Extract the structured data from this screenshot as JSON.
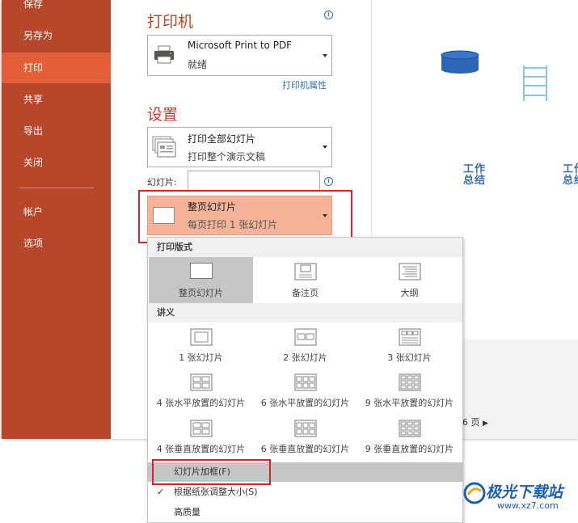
{
  "sidebar": {
    "items": [
      {
        "label": "保存"
      },
      {
        "label": "另存为"
      },
      {
        "label": "打印"
      },
      {
        "label": "共享"
      },
      {
        "label": "导出"
      },
      {
        "label": "关闭"
      },
      {
        "label": "帐户"
      },
      {
        "label": "选项"
      }
    ],
    "active_index": 2,
    "bg_color": "#b7472a",
    "active_color": "#e25f37"
  },
  "printer": {
    "heading": "打印机",
    "name": "Microsoft Print to PDF",
    "status": "就绪",
    "properties_link": "打印机属性"
  },
  "settings": {
    "heading": "设置",
    "range": {
      "title": "打印全部幻灯片",
      "subtitle": "打印整个演示文稿"
    },
    "slides_label": "幻灯片:",
    "slides_value": "",
    "layout": {
      "title": "整页幻灯片",
      "subtitle": "每页打印 1 张幻灯片",
      "highlight_color": "#f5b49a"
    }
  },
  "preview": {
    "texts": [
      "工作\n总结",
      "工作\n总结"
    ],
    "page_count": "6 页"
  },
  "layout_menu": {
    "section_print_layout": "打印版式",
    "print_layout_options": [
      {
        "label": "整页幻灯片",
        "icon": "full-page-slide-icon",
        "selected": true
      },
      {
        "label": "备注页",
        "icon": "notes-page-icon",
        "selected": false
      },
      {
        "label": "大纲",
        "icon": "outline-icon",
        "selected": false
      }
    ],
    "section_handouts": "讲义",
    "handout_options": [
      {
        "label": "1 张幻灯片",
        "icon": "handout-1-icon"
      },
      {
        "label": "2 张幻灯片",
        "icon": "handout-2-icon"
      },
      {
        "label": "3 张幻灯片",
        "icon": "handout-3-icon"
      },
      {
        "label": "4 张水平放置的幻灯片",
        "icon": "handout-4-horizontal-icon"
      },
      {
        "label": "6 张水平放置的幻灯片",
        "icon": "handout-6-horizontal-icon"
      },
      {
        "label": "9 张水平放置的幻灯片",
        "icon": "handout-9-horizontal-icon"
      },
      {
        "label": "4 张垂直放置的幻灯片",
        "icon": "handout-4-vertical-icon"
      },
      {
        "label": "6 张垂直放置的幻灯片",
        "icon": "handout-6-vertical-icon"
      },
      {
        "label": "9 张垂直放置的幻灯片",
        "icon": "handout-9-vertical-icon"
      }
    ],
    "frame_slides": "幻灯片加框(F)",
    "scale_to_fit": "根据纸张调整大小(S)",
    "high_quality": "高质量"
  },
  "annotation_color": "#d0262b",
  "watermark": {
    "text": "极光下载站",
    "url": "www.xz7.com"
  }
}
